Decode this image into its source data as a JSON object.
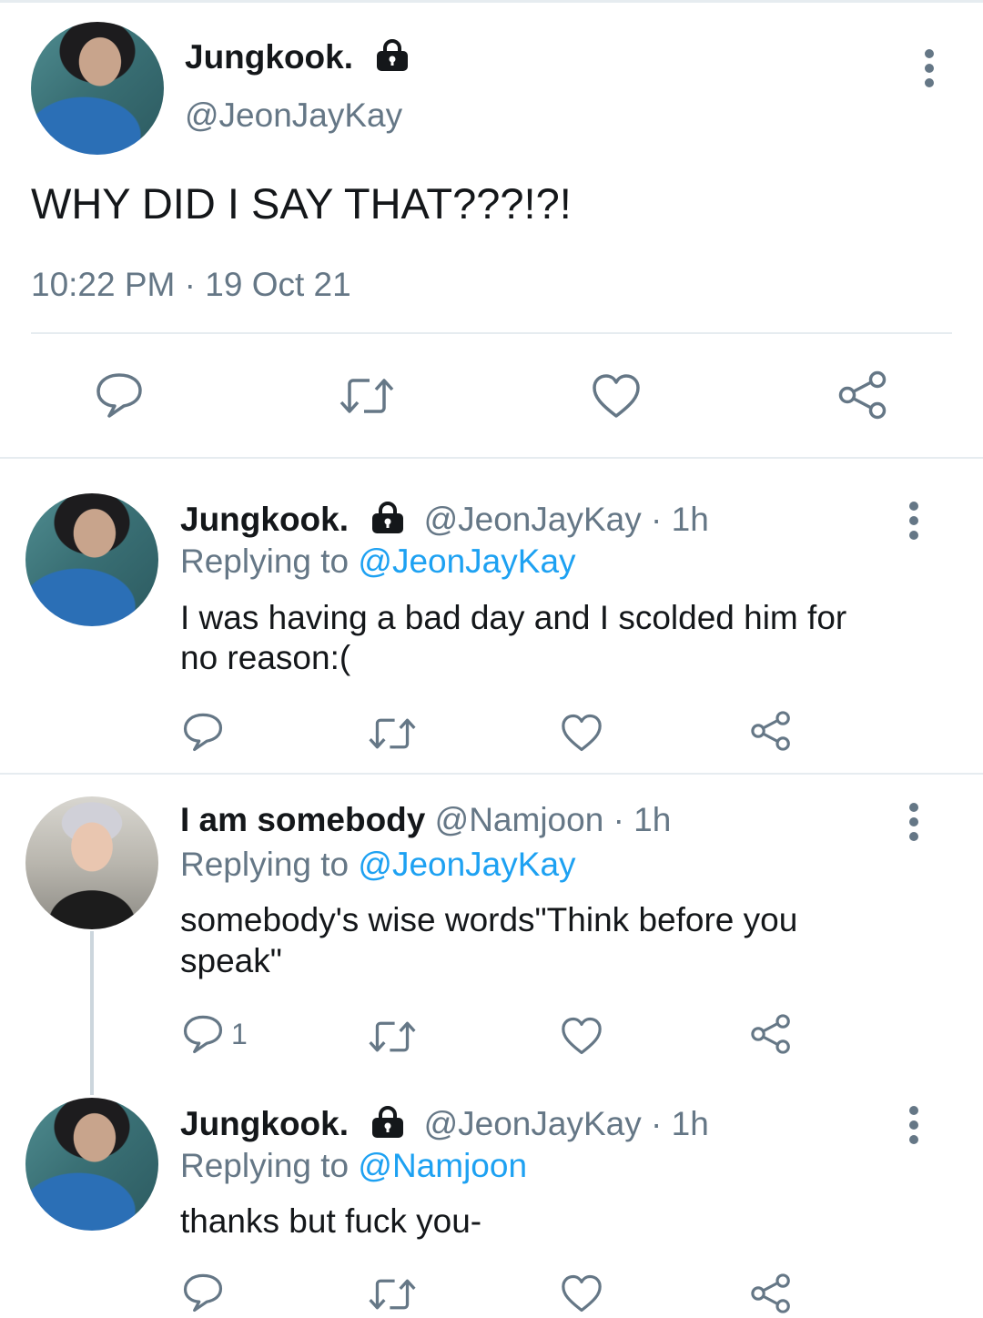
{
  "main_tweet": {
    "display_name": "Jungkook.",
    "handle": "@JeonJayKay",
    "text": "WHY DID I SAY THAT???!?!",
    "time": "10:22 PM",
    "date": "19 Oct 21",
    "protected": true
  },
  "replies": [
    {
      "display_name": "Jungkook.",
      "handle": "@JeonJayKay",
      "age": "1h",
      "replying_prefix": "Replying to",
      "replying_to": "@JeonJayKay",
      "text_line1": "I was having a bad day and I scolded him for",
      "text_line2": "no reason:(",
      "reply_count": ""
    },
    {
      "display_name": "I am somebody",
      "handle": "@Namjoon",
      "age": "1h",
      "replying_prefix": "Replying to",
      "replying_to": "@JeonJayKay",
      "text_line1": "somebody's wise words\"Think before you",
      "text_line2": "speak\"",
      "reply_count": "1"
    },
    {
      "display_name": "Jungkook.",
      "handle": "@JeonJayKay",
      "age": "1h",
      "replying_prefix": "Replying to",
      "replying_to": "@Namjoon",
      "text_line1": "thanks but fuck you-",
      "text_line2": "",
      "reply_count": ""
    }
  ],
  "separator": "·",
  "icons": {
    "reply": "reply-icon",
    "retweet": "retweet-icon",
    "like": "heart-icon",
    "share": "share-icon",
    "more": "more-vertical-icon",
    "lock": "lock-icon"
  },
  "colors": {
    "link": "#1da1f2",
    "secondary": "#657786",
    "text": "#14171a",
    "divider": "#e6ecf0"
  }
}
